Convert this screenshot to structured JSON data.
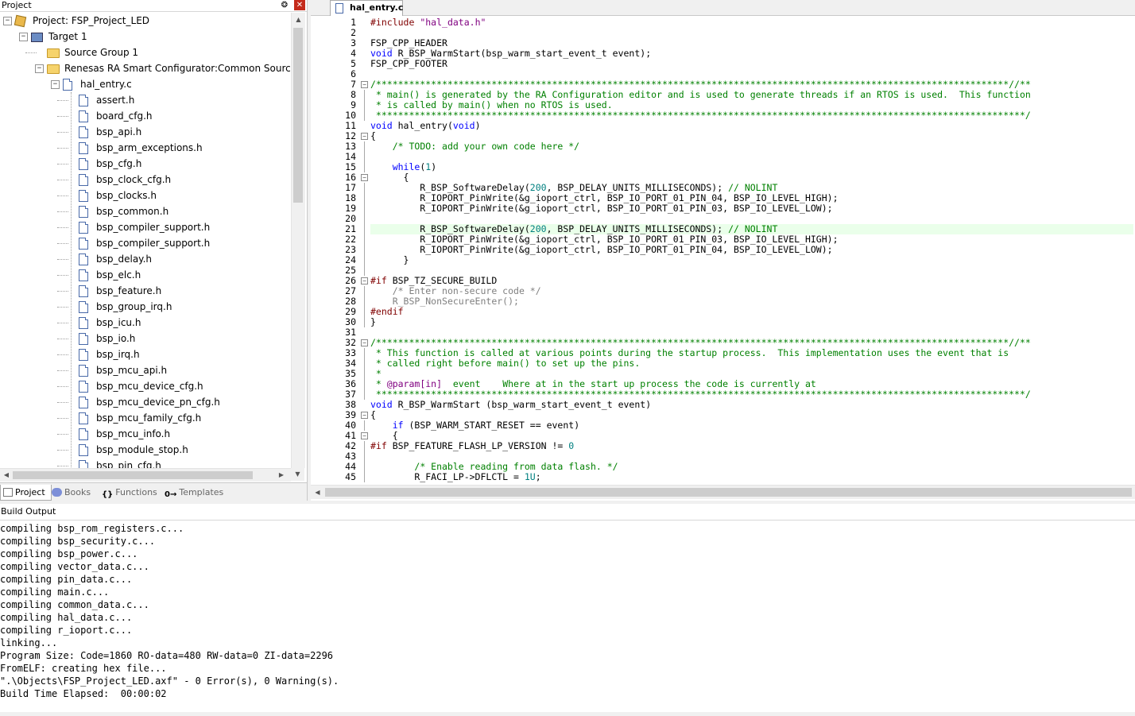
{
  "project_panel": {
    "title": "Project",
    "pin_glyph": "❂",
    "close_glyph": "✕",
    "tree": [
      {
        "label": "Project: FSP_Project_LED",
        "icon": "project-icon",
        "expander": "−"
      },
      {
        "label": "Target 1",
        "icon": "target-icon",
        "expander": "−"
      },
      {
        "label": "Source Group 1",
        "icon": "folder-icon",
        "expander": ""
      },
      {
        "label": "Renesas RA Smart Configurator:Common Sources",
        "icon": "folder-icon",
        "expander": "−"
      },
      {
        "label": "hal_entry.c",
        "icon": "file-icon",
        "expander": "−"
      },
      {
        "label": "assert.h",
        "icon": "file-icon"
      },
      {
        "label": "board_cfg.h",
        "icon": "file-icon"
      },
      {
        "label": "bsp_api.h",
        "icon": "file-icon"
      },
      {
        "label": "bsp_arm_exceptions.h",
        "icon": "file-icon"
      },
      {
        "label": "bsp_cfg.h",
        "icon": "file-icon"
      },
      {
        "label": "bsp_clock_cfg.h",
        "icon": "file-icon"
      },
      {
        "label": "bsp_clocks.h",
        "icon": "file-icon"
      },
      {
        "label": "bsp_common.h",
        "icon": "file-icon"
      },
      {
        "label": "bsp_compiler_support.h",
        "icon": "file-icon"
      },
      {
        "label": "bsp_compiler_support.h",
        "icon": "file-icon"
      },
      {
        "label": "bsp_delay.h",
        "icon": "file-icon"
      },
      {
        "label": "bsp_elc.h",
        "icon": "file-icon"
      },
      {
        "label": "bsp_feature.h",
        "icon": "file-icon"
      },
      {
        "label": "bsp_group_irq.h",
        "icon": "file-icon"
      },
      {
        "label": "bsp_icu.h",
        "icon": "file-icon"
      },
      {
        "label": "bsp_io.h",
        "icon": "file-icon"
      },
      {
        "label": "bsp_irq.h",
        "icon": "file-icon"
      },
      {
        "label": "bsp_mcu_api.h",
        "icon": "file-icon"
      },
      {
        "label": "bsp_mcu_device_cfg.h",
        "icon": "file-icon"
      },
      {
        "label": "bsp_mcu_device_pn_cfg.h",
        "icon": "file-icon"
      },
      {
        "label": "bsp_mcu_family_cfg.h",
        "icon": "file-icon"
      },
      {
        "label": "bsp_mcu_info.h",
        "icon": "file-icon"
      },
      {
        "label": "bsp_module_stop.h",
        "icon": "file-icon"
      },
      {
        "label": "bsp_pin_cfg.h",
        "icon": "file-icon"
      }
    ],
    "tabs": [
      {
        "label": "Project",
        "icon": "project-tab-icon",
        "active": true
      },
      {
        "label": "Books",
        "icon": "books-icon"
      },
      {
        "label": "Functions",
        "icon": "functions-icon",
        "glyph": "{}"
      },
      {
        "label": "Templates",
        "icon": "templates-icon",
        "glyph": "0→"
      }
    ]
  },
  "editor": {
    "tab_label": "hal_entry.c",
    "highlighted_line": 21,
    "folds": [
      7,
      12,
      16,
      26,
      32,
      39,
      41
    ],
    "lines": [
      {
        "n": "1",
        "html": "<span class=\"pp\">#include</span> <span class=\"st\">\"hal_data.h\"</span>"
      },
      {
        "n": "2",
        "html": ""
      },
      {
        "n": "3",
        "html": "FSP_CPP_HEADER"
      },
      {
        "n": "4",
        "html": "<span class=\"kw\">void</span> R_BSP_WarmStart(bsp_warm_start_event_t event);"
      },
      {
        "n": "5",
        "html": "FSP_CPP_FOOTER"
      },
      {
        "n": "6",
        "html": ""
      },
      {
        "n": "7",
        "html": "<span class=\"cm\">/*******************************************************************************************************************//**</span>"
      },
      {
        "n": "8",
        "html": "<span class=\"cm\"> * main() is generated by the RA Configuration editor and is used to generate threads if an RTOS is used.  This function</span>"
      },
      {
        "n": "9",
        "html": "<span class=\"cm\"> * is called by main() when no RTOS is used.</span>"
      },
      {
        "n": "10",
        "html": "<span class=\"cm\"> **********************************************************************************************************************/</span>"
      },
      {
        "n": "11",
        "html": "<span class=\"kw\">void</span> hal_entry(<span class=\"kw\">void</span>)"
      },
      {
        "n": "12",
        "html": "{"
      },
      {
        "n": "13",
        "html": "    <span class=\"cm\">/* TODO: add your own code here */</span>"
      },
      {
        "n": "14",
        "html": ""
      },
      {
        "n": "15",
        "html": "    <span class=\"kw\">while</span>(<span class=\"nm\">1</span>)"
      },
      {
        "n": "16",
        "html": "      {"
      },
      {
        "n": "17",
        "html": "         R_BSP_SoftwareDelay(<span class=\"nm\">200</span>, BSP_DELAY_UNITS_MILLISECONDS); <span class=\"cm\">// NOLINT</span>"
      },
      {
        "n": "18",
        "html": "         R_IOPORT_PinWrite(&amp;g_ioport_ctrl, BSP_IO_PORT_01_PIN_04, BSP_IO_LEVEL_HIGH);"
      },
      {
        "n": "19",
        "html": "         R_IOPORT_PinWrite(&amp;g_ioport_ctrl, BSP_IO_PORT_01_PIN_03, BSP_IO_LEVEL_LOW);"
      },
      {
        "n": "20",
        "html": ""
      },
      {
        "n": "21",
        "html": "         R_BSP_SoftwareDelay(<span class=\"nm\">200</span>, BSP_DELAY_UNITS_MILLISECONDS); <span class=\"cm\">// NOLINT</span>"
      },
      {
        "n": "22",
        "html": "         R_IOPORT_PinWrite(&amp;g_ioport_ctrl, BSP_IO_PORT_01_PIN_03, BSP_IO_LEVEL_HIGH);"
      },
      {
        "n": "23",
        "html": "         R_IOPORT_PinWrite(&amp;g_ioport_ctrl, BSP_IO_PORT_01_PIN_04, BSP_IO_LEVEL_LOW);"
      },
      {
        "n": "24",
        "html": "      }"
      },
      {
        "n": "25",
        "html": ""
      },
      {
        "n": "26",
        "html": "<span class=\"pp\">#if</span> BSP_TZ_SECURE_BUILD"
      },
      {
        "n": "27",
        "html": "    <span class=\"gray\">/* Enter non-secure code */</span>"
      },
      {
        "n": "28",
        "html": "    <span class=\"gray\">R_BSP_NonSecureEnter();</span>"
      },
      {
        "n": "29",
        "html": "<span class=\"pp\">#endif</span>"
      },
      {
        "n": "30",
        "html": "}"
      },
      {
        "n": "31",
        "html": ""
      },
      {
        "n": "32",
        "html": "<span class=\"cm\">/*******************************************************************************************************************//**</span>"
      },
      {
        "n": "33",
        "html": "<span class=\"cm\"> * This function is called at various points during the startup process.  This implementation uses the event that is</span>"
      },
      {
        "n": "34",
        "html": "<span class=\"cm\"> * called right before main() to set up the pins.</span>"
      },
      {
        "n": "35",
        "html": "<span class=\"cm\"> *</span>"
      },
      {
        "n": "36",
        "html": "<span class=\"cm\"> * </span><span class=\"st\">@param[in]</span><span class=\"cm\">  event    Where at in the start up process the code is currently at</span>"
      },
      {
        "n": "37",
        "html": "<span class=\"cm\"> **********************************************************************************************************************/</span>"
      },
      {
        "n": "38",
        "html": "<span class=\"kw\">void</span> R_BSP_WarmStart (bsp_warm_start_event_t event)"
      },
      {
        "n": "39",
        "html": "{"
      },
      {
        "n": "40",
        "html": "    <span class=\"kw\">if</span> (BSP_WARM_START_RESET == event)"
      },
      {
        "n": "41",
        "html": "    {"
      },
      {
        "n": "42",
        "html": "<span class=\"pp\">#if</span> BSP_FEATURE_FLASH_LP_VERSION != <span class=\"nm\">0</span>"
      },
      {
        "n": "43",
        "html": ""
      },
      {
        "n": "44",
        "html": "        <span class=\"cm\">/* Enable reading from data flash. */</span>"
      },
      {
        "n": "45",
        "html": "        R_FACI_LP-&gt;DFLCTL = <span class=\"nm\">1U</span>;"
      }
    ]
  },
  "build_output": {
    "title": "Build Output",
    "lines": [
      "compiling bsp_rom_registers.c...",
      "compiling bsp_security.c...",
      "compiling bsp_power.c...",
      "compiling vector_data.c...",
      "compiling pin_data.c...",
      "compiling main.c...",
      "compiling common_data.c...",
      "compiling hal_data.c...",
      "compiling r_ioport.c...",
      "linking...",
      "Program Size: Code=1860 RO-data=480 RW-data=0 ZI-data=2296",
      "FromELF: creating hex file...",
      "\".\\Objects\\FSP_Project_LED.axf\" - 0 Error(s), 0 Warning(s).",
      "Build Time Elapsed:  00:00:02"
    ]
  },
  "colors": {
    "keyword": "#0000ff",
    "comment": "#008000",
    "string": "#800080",
    "number": "#008080",
    "preprocessor": "#800000",
    "current_line": "#eaffea"
  }
}
